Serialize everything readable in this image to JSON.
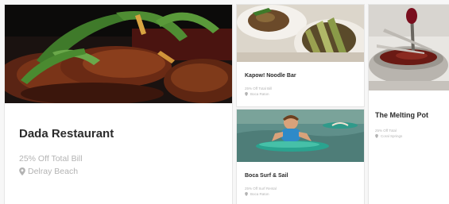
{
  "cards": [
    {
      "name": "Dada Restaurant",
      "deal": "25% Off Total Bill",
      "location": "Delray Beach",
      "icon": "map-pin-icon"
    },
    {
      "name": "Kapow! Noodle Bar",
      "deal": "25% Off Total Bill",
      "location": "Boca Raton",
      "icon": "map-pin-icon"
    },
    {
      "name": "Boca Surf & Sail",
      "deal": "25% Off Surf Rental",
      "location": "Boca Raton",
      "icon": "map-pin-icon"
    },
    {
      "name": "The Melting Pot",
      "deal": "25% Off Total",
      "location": "Coral Springs",
      "icon": "map-pin-icon"
    }
  ],
  "colors": {
    "title": "#2b2b2b",
    "muted": "#b3b3b3",
    "card_bg": "#ffffff"
  }
}
